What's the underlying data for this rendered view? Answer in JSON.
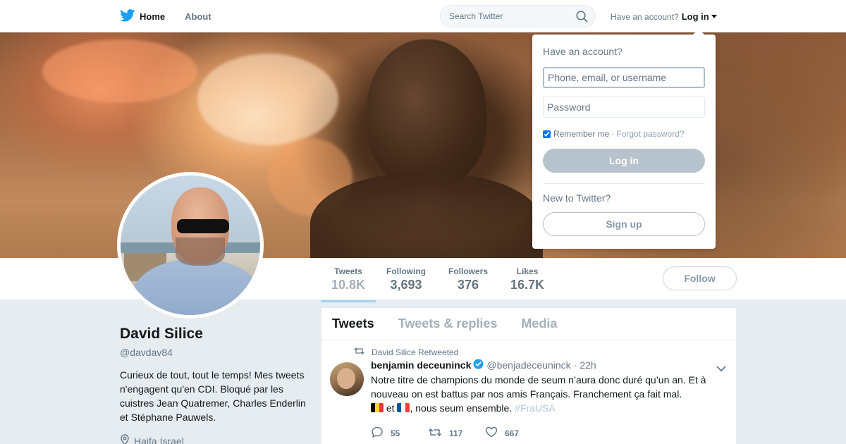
{
  "nav": {
    "home_label": "Home",
    "about_label": "About",
    "search_placeholder": "Search Twitter",
    "have_account_text": "Have an account?",
    "login_label": "Log in"
  },
  "profile": {
    "name": "David Silice",
    "handle": "@davdav84",
    "bio": "Curieux de tout, tout le temps! Mes tweets n'engagent qu'en CDI. Bloqué par les cuistres Jean Quatremer, Charles Enderlin et Stéphane Pauwels.",
    "location": "Haifa Israel"
  },
  "stats": {
    "tweets_label": "Tweets",
    "tweets_value": "10.8K",
    "following_label": "Following",
    "following_value": "3,693",
    "followers_label": "Followers",
    "followers_value": "376",
    "likes_label": "Likes",
    "likes_value": "16.7K",
    "follow_button": "Follow"
  },
  "tabs": {
    "tweets": "Tweets",
    "replies": "Tweets & replies",
    "media": "Media"
  },
  "tweet": {
    "context": "David Silice Retweeted",
    "author_name": "benjamin deceuninck",
    "author_handle": "@benjadeceuninck",
    "time": "22h",
    "text_main": "Notre titre de champions du monde de seum n’aura donc duré qu’un an. Et à nouveau on est battus par nos amis Français. Franchement ça fait mal.",
    "text_et": "et",
    "text_end": ", nous seum ensemble.",
    "hashtag": "#FraUSA",
    "replies": "55",
    "retweets": "117",
    "likes": "667"
  },
  "login_dropdown": {
    "title": "Have an account?",
    "username_placeholder": "Phone, email, or username",
    "password_placeholder": "Password",
    "remember_label": "Remember me",
    "separator": "·",
    "forgot_label": "Forgot password?",
    "login_button": "Log in",
    "new_text": "New to Twitter?",
    "signup_button": "Sign up"
  },
  "colors": {
    "brand_blue": "#1da1f2",
    "background": "#e6ecf0"
  },
  "icons": [
    "twitter-bird-icon",
    "home-icon",
    "search-icon",
    "location-pin-icon",
    "retweet-icon",
    "verified-icon",
    "chevron-down-icon",
    "reply-icon",
    "like-icon",
    "belgium-flag-icon",
    "france-flag-icon"
  ]
}
